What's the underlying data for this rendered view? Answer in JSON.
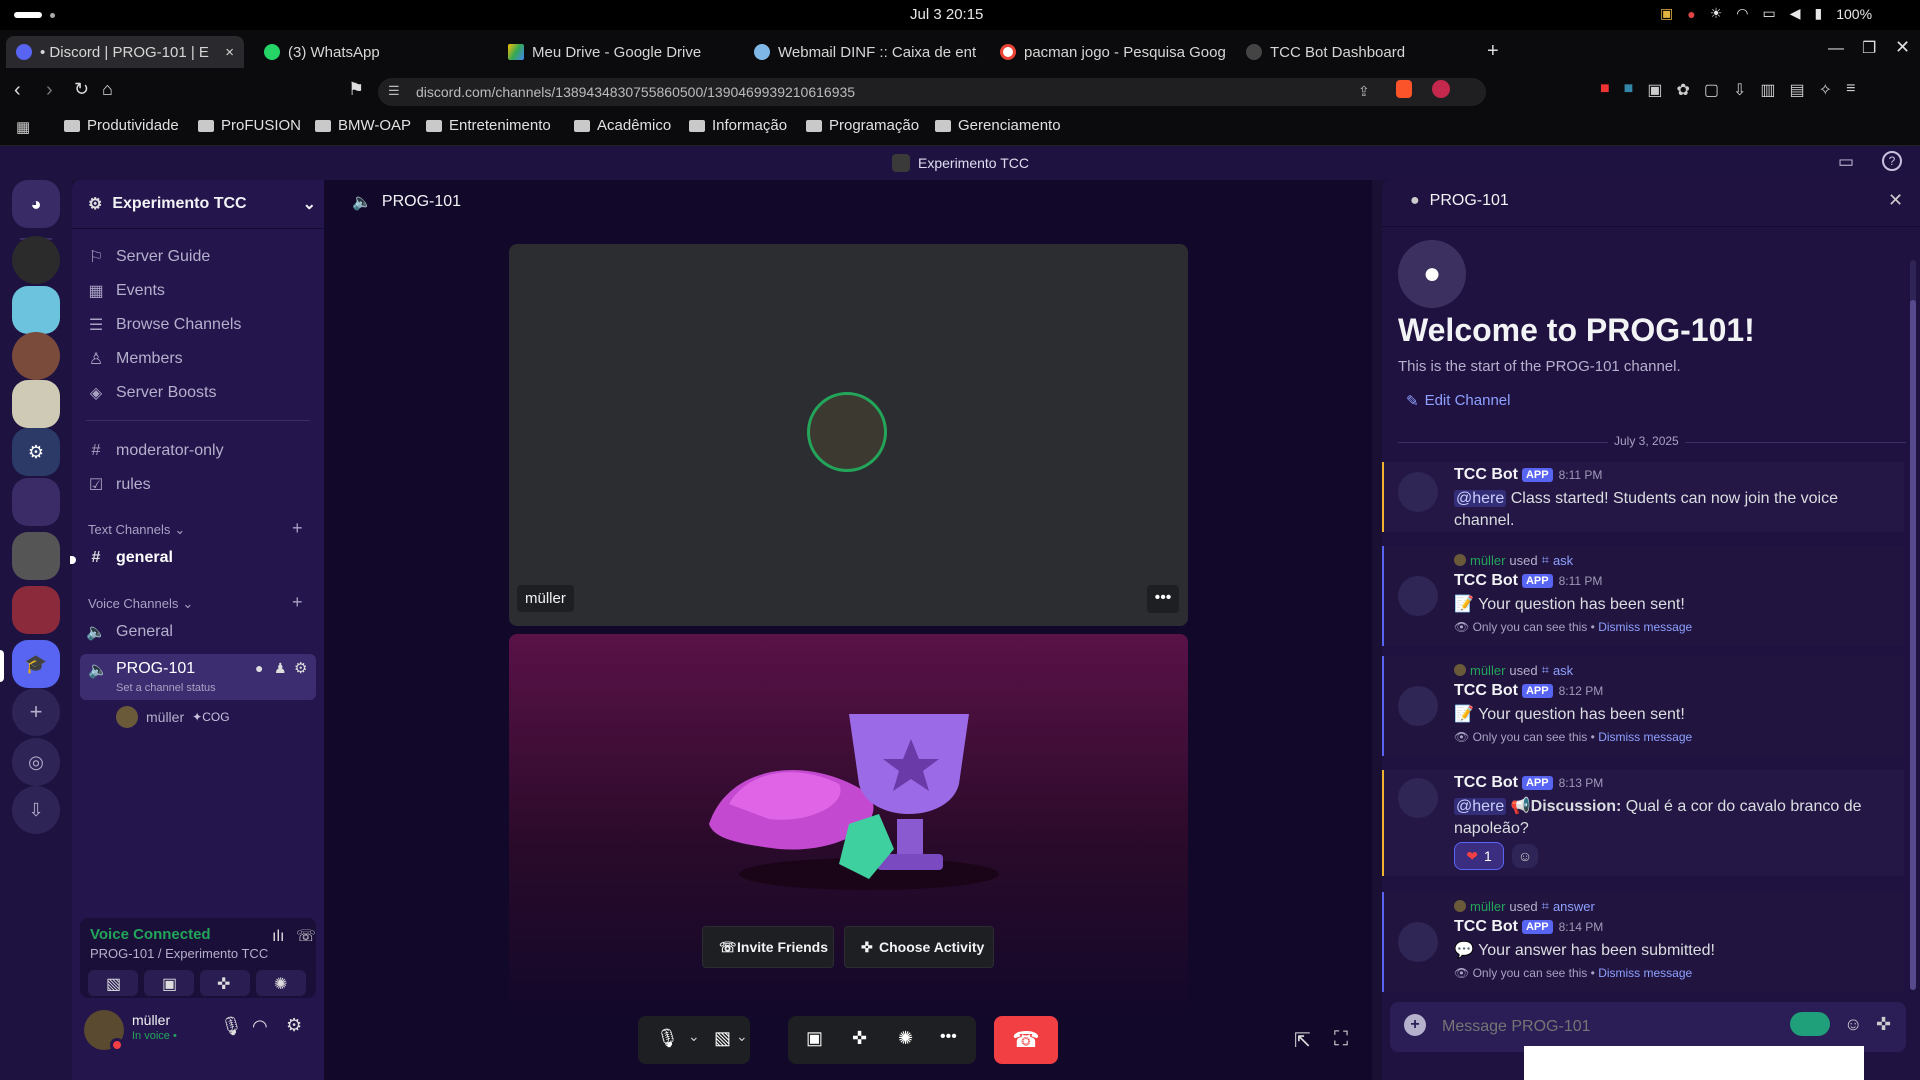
{
  "os": {
    "clock": "Jul 3  20:15",
    "battery": "100%"
  },
  "tabs": [
    {
      "title": "• Discord | PROG-101 | E",
      "active": true,
      "close": "×"
    },
    {
      "title": "(3) WhatsApp"
    },
    {
      "title": "Meu Drive - Google Drive"
    },
    {
      "title": "Webmail DINF :: Caixa de ent"
    },
    {
      "title": "pacman jogo - Pesquisa Goog"
    },
    {
      "title": "TCC Bot Dashboard"
    }
  ],
  "address": {
    "url": "discord.com/channels/1389434830755860500/1390469939210616935"
  },
  "bookmarks": [
    "Produtividade",
    "ProFUSION",
    "BMW-OAP",
    "Entretenimento",
    "Acadêmico",
    "Informação",
    "Programação",
    "Gerenciamento"
  ],
  "discord": {
    "title": "Experimento TCC",
    "server_name": "Experimento TCC",
    "nav": [
      "Server Guide",
      "Events",
      "Browse Channels",
      "Members",
      "Server Boosts"
    ],
    "channels_top": [
      "moderator-only",
      "rules"
    ],
    "text_header": "Text Channels",
    "text_channels": [
      "general"
    ],
    "voice_header": "Voice Channels",
    "voice_channels": [
      "General",
      "PROG-101"
    ],
    "channel_status": "Set a channel status",
    "voice_user": {
      "name": "müller",
      "tag": "COG"
    },
    "voice_panel": {
      "status": "Voice Connected",
      "location": "PROG-101 / Experimento TCC"
    },
    "user_panel": {
      "name": "müller",
      "status": "In voice •"
    },
    "main_header": "PROG-101",
    "tile_name": "müller",
    "activity": {
      "invite": "Invite Friends",
      "choose": "Choose Activity"
    },
    "chat": {
      "header": "PROG-101",
      "welcome": "Welcome to PROG-101!",
      "start": "This is the start of the PROG-101 channel.",
      "edit": "Edit Channel",
      "date": "July 3, 2025",
      "placeholder": "Message PROG-101",
      "messages": [
        {
          "author": "TCC Bot",
          "badge": "APP",
          "time": "8:11 PM",
          "mention": "@here",
          "text": "Class started! Students can now join the voice channel."
        },
        {
          "used_user": "müller",
          "used_word": "used",
          "used_cmd": "ask",
          "author": "TCC Bot",
          "badge": "APP",
          "time": "8:11 PM",
          "emoji": "📝",
          "text": "Your question has been sent!",
          "only": "Only you can see this •",
          "dismiss": "Dismiss message"
        },
        {
          "used_user": "müller",
          "used_word": "used",
          "used_cmd": "ask",
          "author": "TCC Bot",
          "badge": "APP",
          "time": "8:12 PM",
          "emoji": "📝",
          "text": "Your question has been sent!",
          "only": "Only you can see this •",
          "dismiss": "Dismiss message"
        },
        {
          "author": "TCC Bot",
          "badge": "APP",
          "time": "8:13 PM",
          "mention": "@here",
          "emoji": "📢",
          "bold": "Discussion:",
          "text": "Qual é a cor do cavalo branco de napoleão?",
          "reaction_count": "1"
        },
        {
          "used_user": "müller",
          "used_word": "used",
          "used_cmd": "answer",
          "author": "TCC Bot",
          "badge": "APP",
          "time": "8:14 PM",
          "emoji": "💬",
          "text": "Your answer has been submitted!",
          "only": "Only you can see this •",
          "dismiss": "Dismiss message"
        }
      ]
    }
  },
  "colors": {
    "accent": "#5865f2",
    "danger": "#f23f43",
    "online": "#23a55a",
    "link": "#8ea1ff"
  }
}
